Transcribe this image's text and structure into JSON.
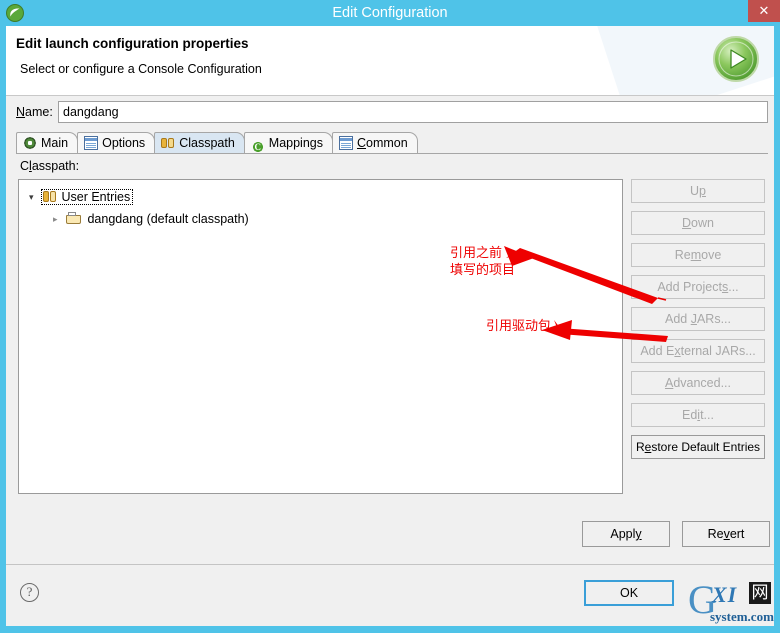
{
  "window": {
    "title": "Edit Configuration",
    "app_icon": "spring-leaf-icon",
    "close_label": "✕",
    "titlebar_color": "#4fc3e8",
    "close_button_color": "#c0504d"
  },
  "header": {
    "title": "Edit launch configuration properties",
    "subtitle": "Select or configure a Console Configuration",
    "run_icon": "green-run-play-icon"
  },
  "name_field": {
    "label": "Name:",
    "label_mnemonic": "N",
    "value": "dangdang",
    "placeholder": ""
  },
  "tabs": [
    {
      "label": "Main",
      "icon": "main-icon",
      "selected": false,
      "mnemonic": ""
    },
    {
      "label": "Options",
      "icon": "options-icon",
      "selected": false,
      "mnemonic": ""
    },
    {
      "label": "Classpath",
      "icon": "classpath-icon",
      "selected": true,
      "mnemonic": ""
    },
    {
      "label": "Mappings",
      "icon": "mappings-icon",
      "selected": false,
      "mnemonic": ""
    },
    {
      "label": "Common",
      "icon": "common-icon",
      "selected": false,
      "mnemonic": "C"
    }
  ],
  "classpath": {
    "section_label": "Classpath:",
    "tree": [
      {
        "label": "User Entries",
        "icon": "classpath-entries-icon",
        "expanded": true,
        "selected": true,
        "level": 0
      },
      {
        "label": "dangdang (default classpath)",
        "icon": "folder-icon",
        "expanded": false,
        "selected": false,
        "level": 1
      }
    ],
    "buttons": [
      {
        "label": "Up",
        "enabled": false
      },
      {
        "label": "Down",
        "enabled": false
      },
      {
        "label": "Remove",
        "enabled": false
      },
      {
        "label": "Add Projects...",
        "enabled": false
      },
      {
        "label": "Add JARs...",
        "enabled": false
      },
      {
        "label": "Add External JARs...",
        "enabled": false
      },
      {
        "label": "Advanced...",
        "enabled": false
      },
      {
        "label": "Edit...",
        "enabled": false
      },
      {
        "label": "Restore Default Entries",
        "enabled": true
      }
    ]
  },
  "footer": {
    "apply_label": "Apply",
    "revert_label": "Revert",
    "ok_label": "OK",
    "help_label": "?"
  },
  "annotations": [
    {
      "id": "project",
      "text": "引用之前\n填写的项目",
      "color": "#ee0000"
    },
    {
      "id": "driver",
      "text": "引用驱动包",
      "color": "#ee0000"
    }
  ],
  "watermark": {
    "g": "G",
    "xi": "XI",
    "wang": "网",
    "sub": "system.com",
    "color": "#2f78b5"
  }
}
